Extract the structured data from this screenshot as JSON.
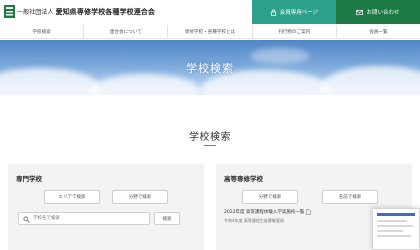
{
  "header": {
    "org_prefix": "一般社団法人",
    "org_name": "愛知県専修学校各種学校連合会",
    "btn_member": "会員専用ページ",
    "btn_contact": "お問い合わせ"
  },
  "nav": {
    "items": [
      "学校検索",
      "連合会について",
      "専修学校・各種学校とは",
      "刊行物のご案内",
      "会員一覧"
    ]
  },
  "hero": {
    "title": "学校検索"
  },
  "section": {
    "title": "学校検索"
  },
  "left_card": {
    "title": "専門学校",
    "btn_area": "エリアで検索",
    "btn_field": "分野で検索",
    "search_placeholder": "学校名で検索",
    "search_button": "検索"
  },
  "right_card": {
    "title": "高等専修学校",
    "btn_field": "分野で検索",
    "btn_name": "名前で検索",
    "doc_link": "2022年度 高等課程体験入学実施校一覧",
    "doc_sub": "令和4年度 高等課程生徒募集要項"
  },
  "colors": {
    "teal": "#2ca08b",
    "green": "#1e7a45"
  }
}
